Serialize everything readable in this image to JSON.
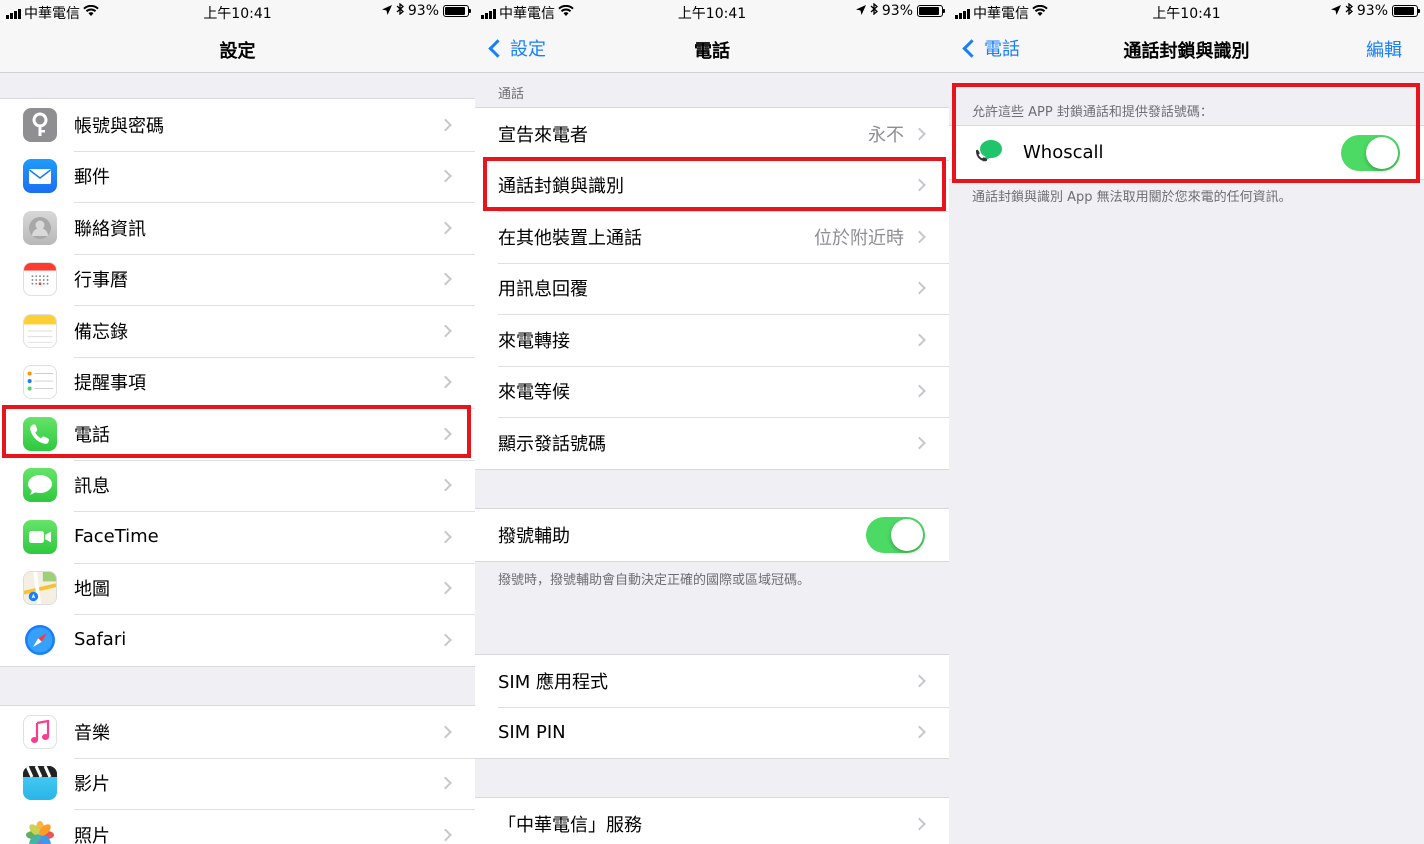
{
  "status_bar": {
    "carrier": "中華電信",
    "time": "上午10:41",
    "battery": "93%",
    "battery_level": 0.93
  },
  "panel1": {
    "title": "設定",
    "group1": [
      {
        "label": "帳號與密碼",
        "icon": "key-icon"
      },
      {
        "label": "郵件",
        "icon": "mail-icon"
      },
      {
        "label": "聯絡資訊",
        "icon": "contacts-icon"
      },
      {
        "label": "行事曆",
        "icon": "calendar-icon"
      },
      {
        "label": "備忘錄",
        "icon": "notes-icon"
      },
      {
        "label": "提醒事項",
        "icon": "reminders-icon"
      },
      {
        "label": "電話",
        "icon": "phone-icon"
      },
      {
        "label": "訊息",
        "icon": "messages-icon"
      },
      {
        "label": "FaceTime",
        "icon": "facetime-icon"
      },
      {
        "label": "地圖",
        "icon": "maps-icon"
      },
      {
        "label": "Safari",
        "icon": "safari-icon"
      }
    ],
    "group2": [
      {
        "label": "音樂",
        "icon": "music-icon"
      },
      {
        "label": "影片",
        "icon": "videos-icon"
      },
      {
        "label": "照片",
        "icon": "photos-icon"
      }
    ]
  },
  "panel2": {
    "back": "設定",
    "title": "電話",
    "section_header": "通話",
    "group1": [
      {
        "label": "宣告來電者",
        "value": "永不"
      },
      {
        "label": "通話封鎖與識別",
        "value": ""
      },
      {
        "label": "在其他裝置上通話",
        "value": "位於附近時"
      },
      {
        "label": "用訊息回覆",
        "value": ""
      },
      {
        "label": "來電轉接",
        "value": ""
      },
      {
        "label": "來電等候",
        "value": ""
      },
      {
        "label": "顯示發話號碼",
        "value": ""
      }
    ],
    "dial_assist": {
      "label": "撥號輔助",
      "on": true
    },
    "dial_assist_note": "撥號時，撥號輔助會自動決定正確的國際或區域冠碼。",
    "group3": [
      {
        "label": "SIM 應用程式"
      },
      {
        "label": "SIM PIN"
      }
    ],
    "group4": [
      {
        "label": "「中華電信」服務"
      }
    ]
  },
  "panel3": {
    "back": "電話",
    "title": "通話封鎖與識別",
    "edit": "編輯",
    "section_header": "允許這些 APP 封鎖通話和提供發話號碼：",
    "app": {
      "label": "Whoscall",
      "on": true
    },
    "footer": "通話封鎖與識別 App 無法取用關於您來電的任何資訊。"
  },
  "colors": {
    "accent": "#1a7ffb",
    "toggle_on": "#4cd964",
    "highlight": "#e8141c",
    "background": "#efeff4"
  }
}
